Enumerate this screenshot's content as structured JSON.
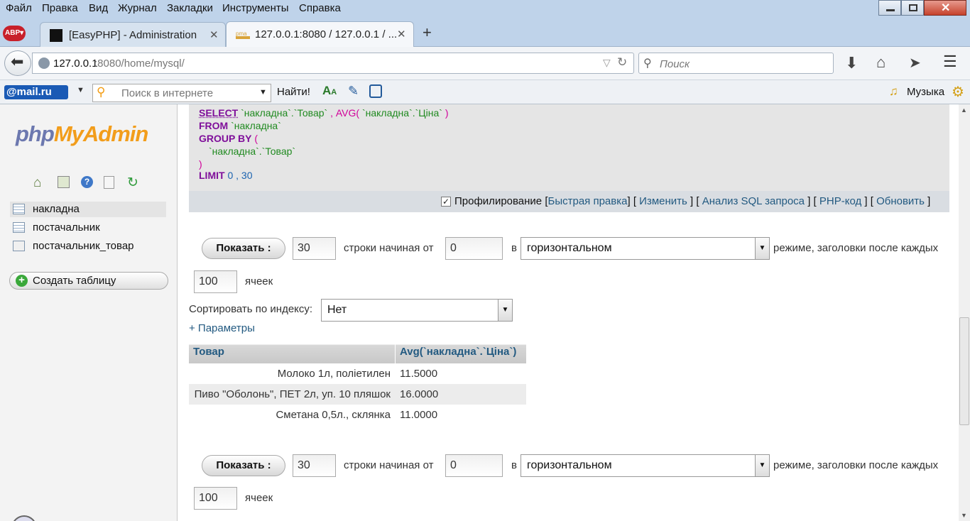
{
  "menubar": {
    "items": [
      "Файл",
      "Правка",
      "Вид",
      "Журнал",
      "Закладки",
      "Инструменты",
      "Справка"
    ]
  },
  "tabs": [
    {
      "label": "[EasyPHP] - Administration"
    },
    {
      "label": "127.0.0.1:8080 / 127.0.0.1 / ..."
    }
  ],
  "addressbar": {
    "url_host": "127.0.0.1",
    "url_rest": ":8080/home/mysql/",
    "search_placeholder": "Поиск"
  },
  "mailru_bar": {
    "logo": "@mail.ru",
    "search_placeholder": "Поиск в интернете",
    "find_label": "Найти!",
    "music_label": "Музыка"
  },
  "sidebar": {
    "logo_php": "php",
    "logo_myadmin": "MyAdmin",
    "tables": [
      {
        "label": "накладна"
      },
      {
        "label": "постачальник"
      },
      {
        "label": "постачальник_товар"
      }
    ],
    "create_table_label": "Создать таблицу"
  },
  "sql": {
    "select_kw": "SELECT",
    "select_rest_a": "`накладна`.`Товар`",
    "comma": " ,",
    "avg_fn": "AVG(",
    "avg_arg": " `накладна`.`Ціна`",
    "avg_close": " )",
    "from_kw": "FROM",
    "from_rest": "`накладна`",
    "group_kw": "GROUP BY",
    "group_open": "(",
    "group_field": "`накладна`.`Товар`",
    "group_close": ")",
    "limit_kw": "LIMIT",
    "limit_a": "0",
    "limit_sep": ",",
    "limit_b": "30"
  },
  "sqlbar": {
    "profiling_label": "Профилирование",
    "open_bracket": "[",
    "close_bracket": "]",
    "links": [
      "Быстрая правка",
      "Изменить",
      "Анализ SQL запроса",
      "PHP-код",
      "Обновить"
    ]
  },
  "nav_controls": {
    "show_label": "Показать :",
    "rows_value": "30",
    "rows_text": "строки начиная от",
    "start_value": "0",
    "in_text": "в",
    "mode_value": "горизонтальном",
    "mode_text": "режиме, заголовки после каждых",
    "header_every_value": "100",
    "cells_text": "ячеек"
  },
  "sort": {
    "label": "Сортировать по индексу:",
    "value": "Нет"
  },
  "params_link": "+ Параметры",
  "results": {
    "columns": [
      "Товар",
      "Avg(`накладна`.`Ціна`)"
    ],
    "rows": [
      [
        "Молоко 1л, поліетилен",
        "11.5000"
      ],
      [
        "Пиво \"Оболонь\", ПЕТ 2л, уп. 10 пляшок",
        "16.0000"
      ],
      [
        "Сметана 0,5л., склянка",
        "11.0000"
      ]
    ]
  }
}
